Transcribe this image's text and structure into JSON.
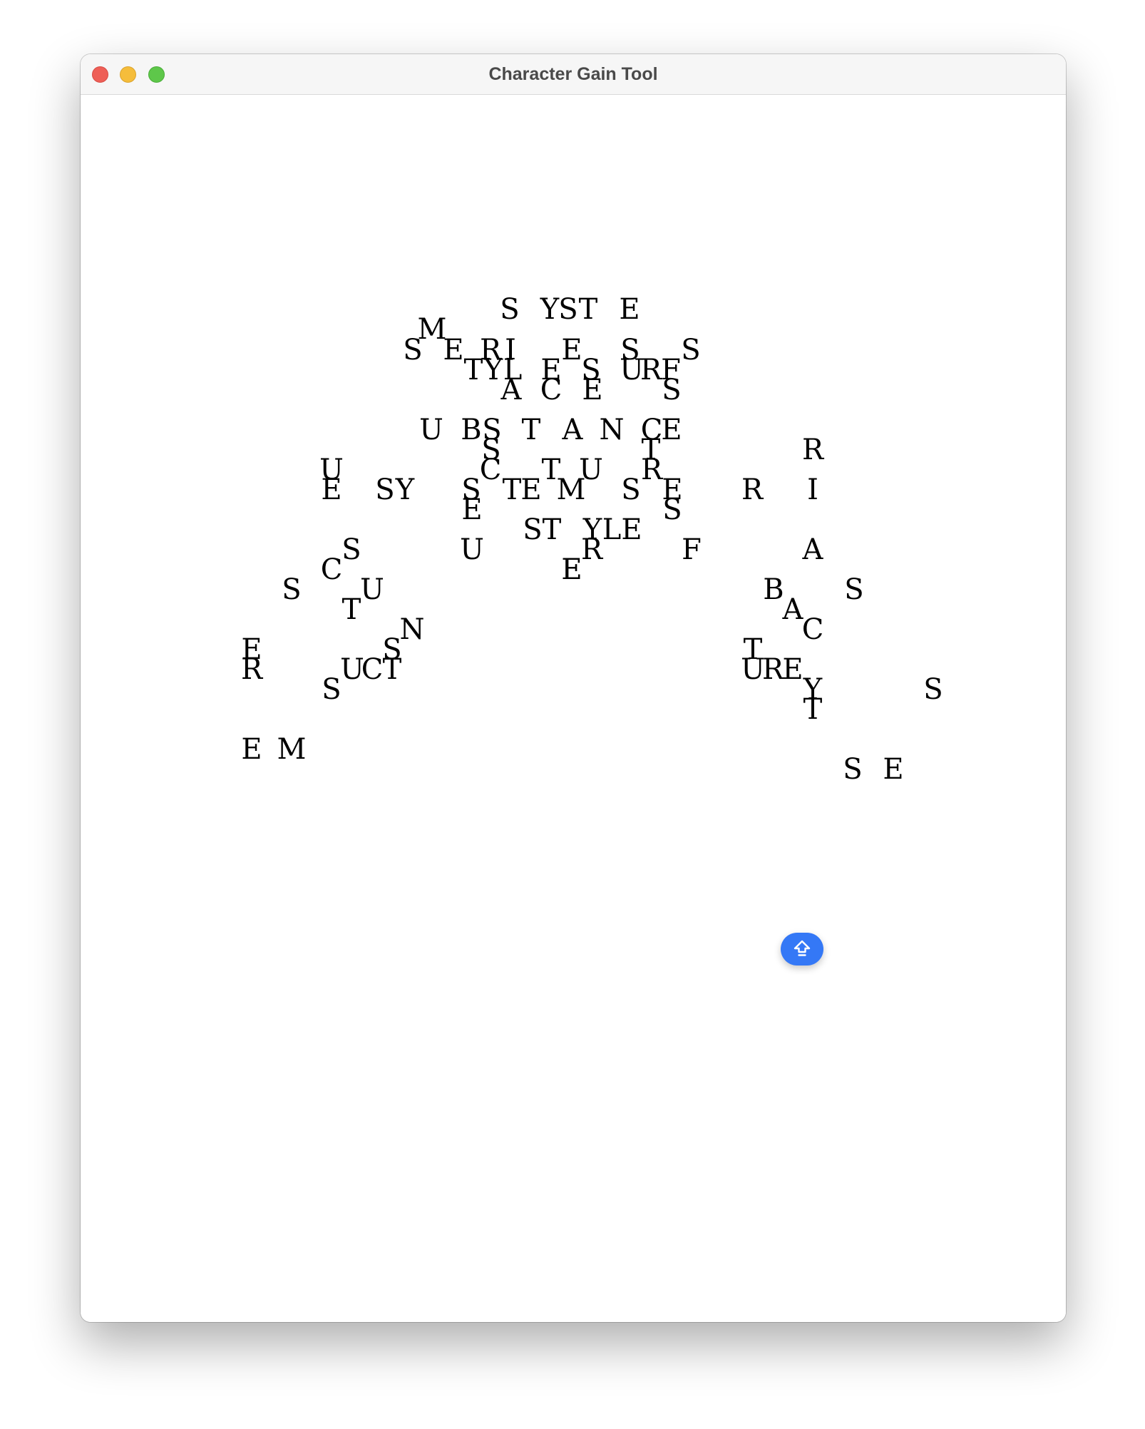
{
  "window": {
    "title": "Character Gain Tool"
  },
  "fab": {
    "icon": "upload-arrow-icon",
    "color": "#3478f6"
  },
  "glyphs": [
    "S",
    "Y",
    "S",
    "T",
    "E",
    "M",
    "S",
    "E",
    "R",
    "I",
    "E",
    "S",
    "S",
    "T",
    "Y",
    "L",
    "E",
    "S",
    "U",
    "R",
    "F",
    "A",
    "C",
    "E",
    "S",
    "U",
    "B",
    "S",
    "T",
    "A",
    "N",
    "C",
    "E",
    "S",
    "T",
    "R",
    "U",
    "C",
    "T",
    "U",
    "R",
    "E",
    "S",
    "Y",
    "S",
    "T",
    "E",
    "M",
    "S",
    "E",
    "R",
    "I",
    "E",
    "S",
    "S",
    "T",
    "Y",
    "L",
    "E",
    "S",
    "U",
    "R",
    "E",
    "F",
    "A",
    "C",
    "E",
    "S",
    "U",
    "B",
    "S",
    "T",
    "A",
    "N",
    "C",
    "E",
    "S",
    "T",
    "R",
    "U",
    "C",
    "T",
    "U",
    "R",
    "E",
    "Y",
    "S",
    "S",
    "T",
    "E",
    "M",
    "S",
    "E"
  ]
}
